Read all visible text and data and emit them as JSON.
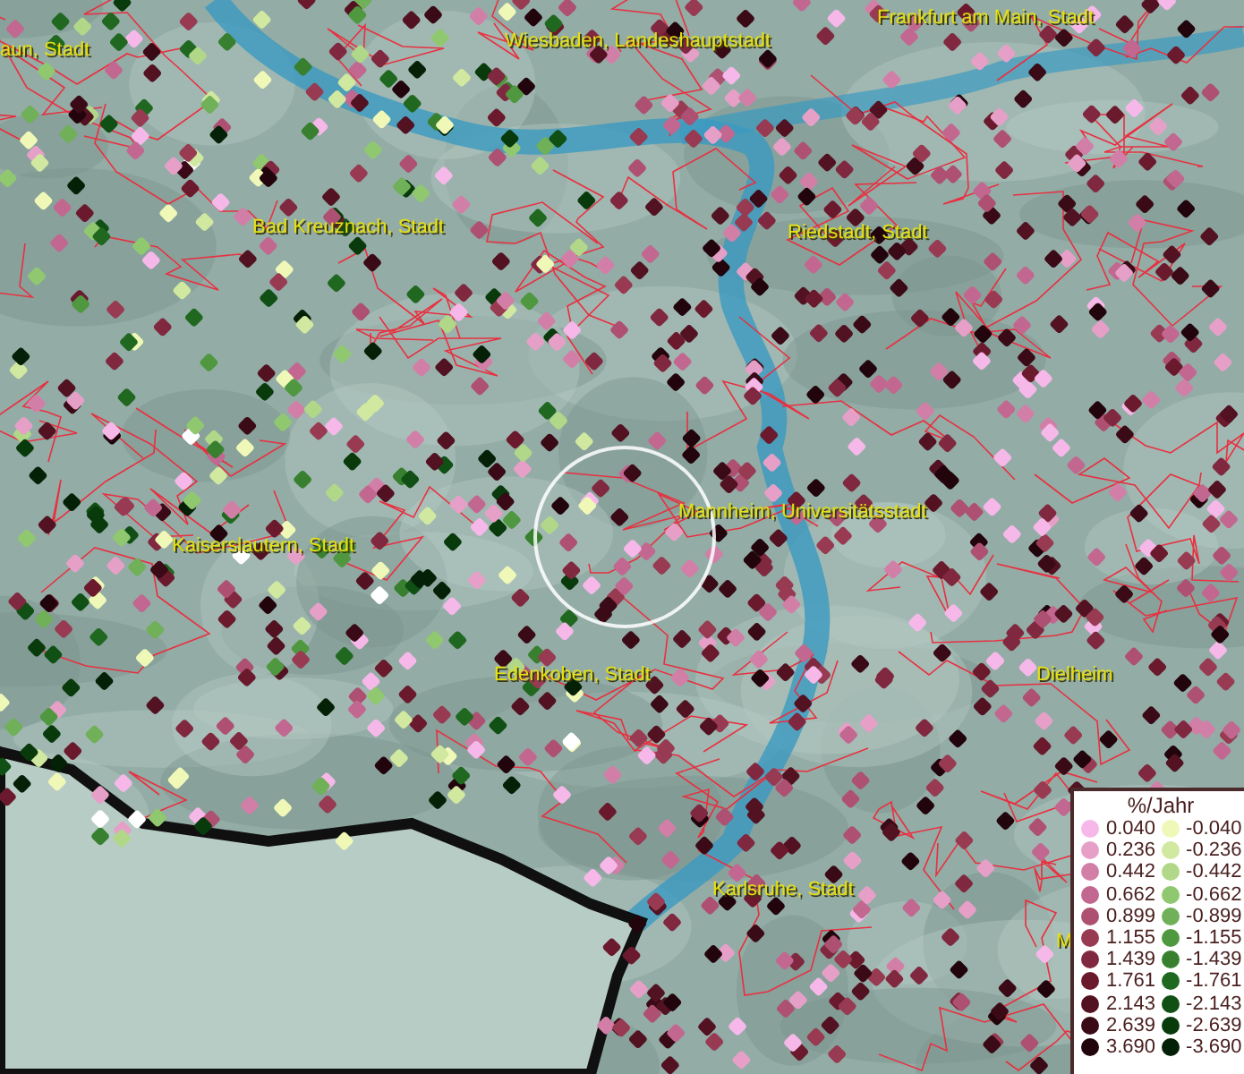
{
  "map": {
    "labels": [
      {
        "text": "aun, Stadt"
      },
      {
        "text": "Wiesbaden, Landeshauptstadt"
      },
      {
        "text": "Frankfurt am Main, Stadt"
      },
      {
        "text": "Bad Kreuznach, Stadt"
      },
      {
        "text": "Riedstadt, Stadt"
      },
      {
        "text": "Kaiserslautern, Stadt"
      },
      {
        "text": "Mannheim, Universitätsstadt"
      },
      {
        "text": "Edenkoben, Stadt"
      },
      {
        "text": "Dielheim"
      },
      {
        "text": "Karlsruhe, Stadt"
      },
      {
        "text": "M"
      }
    ]
  },
  "legend": {
    "title": "%/Jahr",
    "columns": [
      [
        {
          "value": "0.040",
          "color": "#f5b8e8"
        },
        {
          "value": "0.236",
          "color": "#e6a0c8"
        },
        {
          "value": "0.442",
          "color": "#d27fa8"
        },
        {
          "value": "0.662",
          "color": "#c26890"
        },
        {
          "value": "0.899",
          "color": "#ae5072"
        },
        {
          "value": "1.155",
          "color": "#983a52"
        },
        {
          "value": "1.439",
          "color": "#80283f"
        },
        {
          "value": "1.761",
          "color": "#6a1a2c"
        },
        {
          "value": "2.143",
          "color": "#521222"
        },
        {
          "value": "2.639",
          "color": "#3a0a16"
        },
        {
          "value": "3.690",
          "color": "#22040c"
        }
      ],
      [
        {
          "value": "-0.040",
          "color": "#f0f8b8"
        },
        {
          "value": "-0.236",
          "color": "#d0e8a0"
        },
        {
          "value": "-0.442",
          "color": "#b0d888"
        },
        {
          "value": "-0.662",
          "color": "#90c870"
        },
        {
          "value": "-0.899",
          "color": "#70b058"
        },
        {
          "value": "-1.155",
          "color": "#509840"
        },
        {
          "value": "-1.439",
          "color": "#388030"
        },
        {
          "value": "-1.761",
          "color": "#206820"
        },
        {
          "value": "-2.143",
          "color": "#105014"
        },
        {
          "value": "-2.639",
          "color": "#083a0c"
        },
        {
          "value": "-3.690",
          "color": "#042006"
        }
      ]
    ]
  }
}
